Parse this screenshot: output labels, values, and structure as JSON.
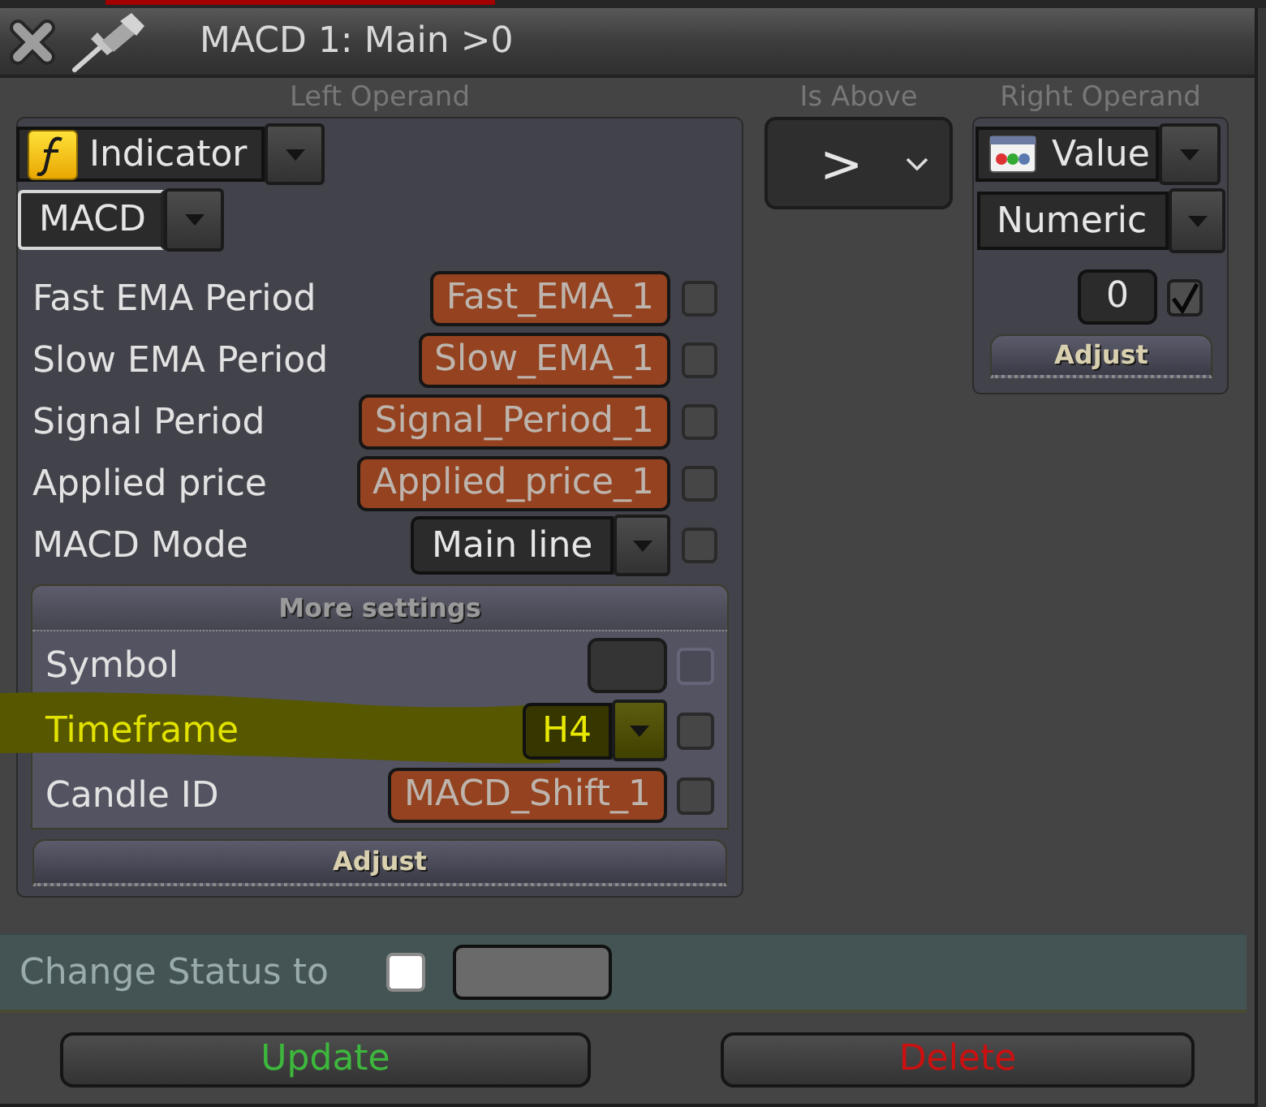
{
  "window": {
    "title": "MACD 1: Main >0"
  },
  "left_operand": {
    "label": "Left Operand",
    "source": "Indicator",
    "indicator": {
      "value": "MACD",
      "focused": true
    },
    "parameters": [
      {
        "kind": "text",
        "label": "Fast EMA Period",
        "value": "Fast_EMA_1",
        "checked": false
      },
      {
        "kind": "text",
        "label": "Slow EMA Period",
        "value": "Slow_EMA_1",
        "checked": false
      },
      {
        "kind": "text",
        "label": "Signal Period",
        "value": "Signal_Period_1",
        "checked": false
      },
      {
        "kind": "text",
        "label": "Applied price",
        "value": "Applied_price_1",
        "checked": false
      },
      {
        "kind": "dropdown",
        "label": "MACD Mode",
        "value": "Main line",
        "checked": false
      }
    ],
    "more_settings": {
      "title": "More settings",
      "rows": [
        {
          "kind": "empty",
          "label": "Symbol",
          "checked": false,
          "disabled": true,
          "highlighted": false
        },
        {
          "kind": "dropdown",
          "label": "Timeframe",
          "value": "H4",
          "checked": false,
          "disabled": false,
          "highlighted": true
        },
        {
          "kind": "text",
          "label": "Candle ID",
          "value": "MACD_Shift_1",
          "checked": false,
          "disabled": false,
          "highlighted": false
        }
      ]
    },
    "adjust_button": "Adjust"
  },
  "comparison": {
    "label": "Is Above",
    "value": ">"
  },
  "right_operand": {
    "label": "Right Operand",
    "source": "Value",
    "type": "Numeric",
    "value": "0",
    "checked": true,
    "adjust_button": "Adjust"
  },
  "change_status": {
    "label": "Change Status to",
    "checked": false
  },
  "buttons": [
    {
      "kind": "update",
      "label": "Update"
    },
    {
      "kind": "delete",
      "label": "Delete"
    }
  ]
}
